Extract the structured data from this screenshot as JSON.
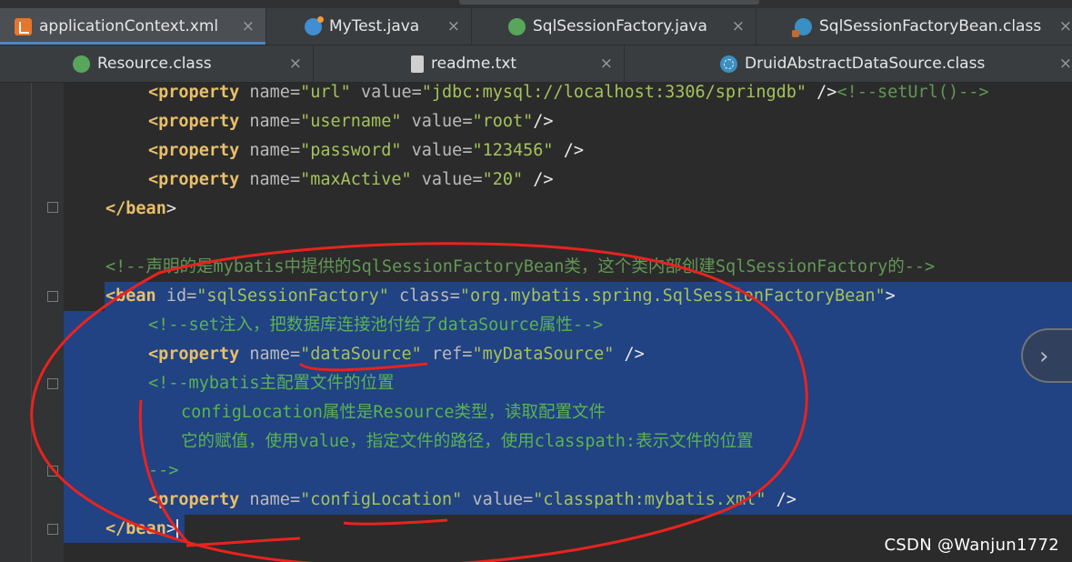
{
  "tabs_row1": [
    {
      "label": "applicationContext.xml",
      "icon": "xml-file-icon",
      "active": true
    },
    {
      "label": "MyTest.java",
      "icon": "java-class-icon",
      "active": false
    },
    {
      "label": "SqlSessionFactory.java",
      "icon": "interface-icon",
      "active": false
    },
    {
      "label": "SqlSessionFactoryBean.class",
      "icon": "class-file-icon",
      "active": false
    }
  ],
  "tabs_row2": [
    {
      "label": "Resource.class",
      "icon": "interface-icon",
      "active": false
    },
    {
      "label": "readme.txt",
      "icon": "text-file-icon",
      "active": false
    },
    {
      "label": "DruidAbstractDataSource.class",
      "icon": "abstract-class-icon",
      "active": false
    }
  ],
  "close_glyph": "×",
  "code": {
    "l1": {
      "open": "<",
      "tag": "property",
      "a1": "name=",
      "v1": "\"url\"",
      "a2": "value=",
      "v2": "\"jdbc:mysql://localhost:3306/springdb\"",
      "end": " />",
      "comment": "<!--setUrl()-->"
    },
    "l2": {
      "open": "<",
      "tag": "property",
      "a1": "name=",
      "v1": "\"username\"",
      "a2": "value=",
      "v2": "\"root\"",
      "end": "/>"
    },
    "l3": {
      "open": "<",
      "tag": "property",
      "a1": "name=",
      "v1": "\"password\"",
      "a2": "value=",
      "v2": "\"123456\"",
      "end": " />"
    },
    "l4": {
      "open": "<",
      "tag": "property",
      "a1": "name=",
      "v1": "\"maxActive\"",
      "a2": "value=",
      "v2": "\"20\"",
      "end": " />"
    },
    "l5": {
      "open": "</",
      "tag": "bean",
      "end": ">"
    },
    "l6": {
      "comment": "<!--声明的是mybatis中提供的SqlSessionFactoryBean类，这个类内部创建SqlSessionFactory的-->"
    },
    "l7": {
      "open": "<",
      "tag": "bean",
      "a1": "id=",
      "v1": "\"sqlSessionFactory\"",
      "a2": "class=",
      "v2": "\"org.mybatis.spring.SqlSessionFactoryBean\"",
      "end": ">"
    },
    "l8": {
      "comment": "<!--set注入，把数据库连接池付给了dataSource属性-->"
    },
    "l9": {
      "open": "<",
      "tag": "property",
      "a1": "name=",
      "v1": "\"dataSource\"",
      "a2": "ref=",
      "v2": "\"myDataSource\"",
      "end": " />"
    },
    "l10": {
      "comment": "<!--mybatis主配置文件的位置"
    },
    "l11": {
      "comment": "configLocation属性是Resource类型，读取配置文件"
    },
    "l12": {
      "comment": "它的赋值，使用value，指定文件的路径，使用classpath:表示文件的位置"
    },
    "l13": {
      "comment": "-->"
    },
    "l14": {
      "open": "<",
      "tag": "property",
      "a1": "name=",
      "v1": "\"configLocation\"",
      "a2": "value=",
      "v2": "\"classpath:mybatis.xml\"",
      "end": " />"
    },
    "l15": {
      "open": "</",
      "tag": "bean",
      "end": ">"
    }
  },
  "watermark": "CSDN @Wanjun1772",
  "colors": {
    "tag": "#e8bf6a",
    "attr": "#bababa",
    "value": "#a5c25c",
    "comment": "#629755",
    "selection": "#214283",
    "annotation": "#e8231f",
    "active_tab_underline": "#4a88c7"
  }
}
